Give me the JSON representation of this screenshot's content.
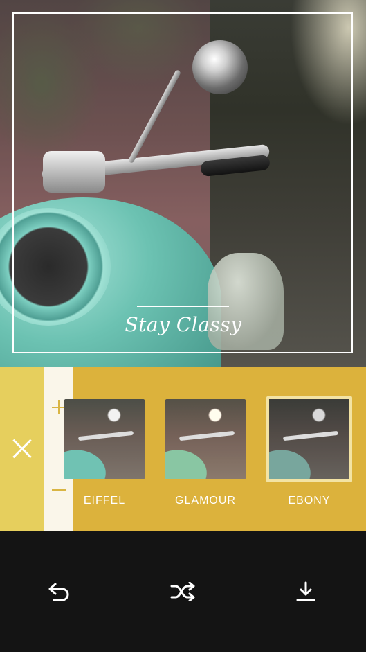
{
  "photo": {
    "overlay_title": "Stay Classy"
  },
  "filter_panel": {
    "close_icon": "close-icon",
    "intensity": {
      "increase_icon": "plus-icon",
      "decrease_icon": "minus-icon"
    },
    "filters": [
      {
        "label": "EIFFEL",
        "selected": false
      },
      {
        "label": "GLAMOUR",
        "selected": false
      },
      {
        "label": "EBONY",
        "selected": true
      }
    ],
    "colors": {
      "panel": "#dcb23c",
      "close_panel": "#e6cf5d",
      "intensity_bar": "#faf6ea",
      "selected_border": "#f3e3a4"
    }
  },
  "toolbar": {
    "buttons": [
      {
        "icon": "undo-icon"
      },
      {
        "icon": "shuffle-icon"
      },
      {
        "icon": "download-icon"
      }
    ],
    "background": "#141414"
  }
}
